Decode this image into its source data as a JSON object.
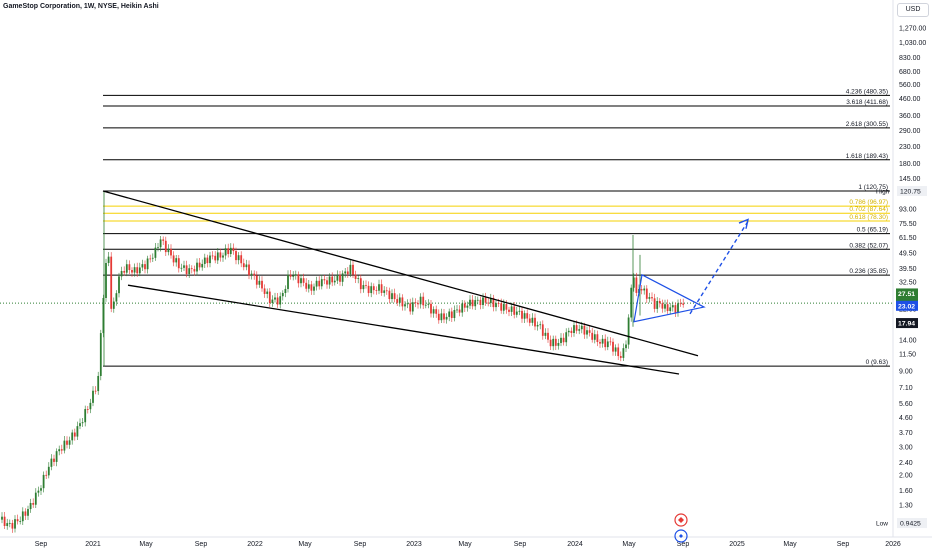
{
  "header": {
    "title": "GameStop Corporation, 1W, NYSE, Heikin Ashi",
    "currency": "USD"
  },
  "colors": {
    "up": "#26a69a",
    "up_candle": "#2e7d32",
    "down": "#e53935",
    "fib_line": "#000000",
    "fib_gold": "#f5d000",
    "triangle": "#1e50e6",
    "projection": "#1e50e6",
    "current_price_line": "#2e7d32",
    "bg": "#ffffff",
    "axis_text": "#131722"
  },
  "chart_data": {
    "type": "candlestick",
    "scale": "log",
    "x_ticks": [
      "Sep",
      "2021",
      "May",
      "Sep",
      "2022",
      "May",
      "Sep",
      "2023",
      "May",
      "Sep",
      "2024",
      "May",
      "Sep",
      "2025",
      "May",
      "Sep",
      "2026"
    ],
    "y_ticks": [
      1,
      1.3,
      1.6,
      2.0,
      2.4,
      3.0,
      3.7,
      4.6,
      5.6,
      7.1,
      9.0,
      11.5,
      14.0,
      17.5,
      22.0,
      27.0,
      32.5,
      39.5,
      49.5,
      61.5,
      75.5,
      93.0,
      145.0,
      180.0,
      230.0,
      290.0,
      360.0,
      460.0,
      560.0,
      680.0,
      830.0,
      1030.0,
      1270.0
    ],
    "y_tick_labels": [
      "1.06",
      "1.30",
      "1.60",
      "2.00",
      "2.40",
      "3.00",
      "3.70",
      "4.60",
      "5.60",
      "7.10",
      "9.00",
      "11.50",
      "14.00",
      "17.50",
      "22.00",
      "27.00",
      "32.50",
      "39.50",
      "49.50",
      "61.50",
      "75.50",
      "93.00",
      "145.00",
      "180.00",
      "230.00",
      "290.00",
      "360.00",
      "460.00",
      "560.00",
      "680.00",
      "830.00",
      "1,030.00",
      "1,270.00"
    ],
    "ylim": [
      0.87,
      1560
    ],
    "fib_levels": [
      {
        "ratio": "4.236",
        "price": 480.35,
        "label": "4.236 (480.35)",
        "style": "black"
      },
      {
        "ratio": "3.618",
        "price": 411.68,
        "label": "3.618 (411.68)",
        "style": "black"
      },
      {
        "ratio": "2.618",
        "price": 300.55,
        "label": "2.618 (300.55)",
        "style": "black"
      },
      {
        "ratio": "1.618",
        "price": 189.43,
        "label": "1.618 (189.43)",
        "style": "black"
      },
      {
        "ratio": "1",
        "price": 120.75,
        "label": "1 (120.75)",
        "style": "black"
      },
      {
        "ratio": "0.786",
        "price": 96.97,
        "label": "0.786 (96.97)",
        "style": "gold"
      },
      {
        "ratio": "0.702",
        "price": 87.64,
        "label": "0.702 (87.64)",
        "style": "gold"
      },
      {
        "ratio": "0.618",
        "price": 78.3,
        "label": "0.618 (78.30)",
        "style": "gold"
      },
      {
        "ratio": "0.5",
        "price": 65.19,
        "label": "0.5 (65.19)",
        "style": "black"
      },
      {
        "ratio": "0.382",
        "price": 52.07,
        "label": "0.382 (52.07)",
        "style": "black"
      },
      {
        "ratio": "0.236",
        "price": 35.85,
        "label": "0.236 (35.85)",
        "style": "black"
      },
      {
        "ratio": "0",
        "price": 9.63,
        "label": "0 (9.63)",
        "style": "black"
      }
    ],
    "price_badges": [
      {
        "text": "High",
        "value": "120.75",
        "kind": "plain"
      },
      {
        "text": "",
        "value": "27.51",
        "kind": "green"
      },
      {
        "text": "",
        "value": "23.92",
        "kind": "green"
      },
      {
        "text": "",
        "value": "23.02",
        "kind": "blue"
      },
      {
        "text": "",
        "value": "17.94",
        "kind": "dark"
      },
      {
        "text": "Low",
        "value": "0.9425",
        "kind": "plain"
      }
    ],
    "current_price": 23.92,
    "high": 120.75,
    "low": 0.9425,
    "annotations": {
      "upper_trendline": "descending resistance from 2021 high to 2024",
      "lower_trendline": "descending support 2021-2024",
      "symmetrical_triangle": "2024 consolidation",
      "projection_arrow": "breakout target toward ~78"
    },
    "candles_weekly_close": [
      [
        0,
        1.05
      ],
      [
        1,
        1.1
      ],
      [
        2,
        1.2
      ],
      [
        3,
        1.3
      ],
      [
        4,
        1.5
      ],
      [
        5,
        1.7
      ],
      [
        6,
        2.0
      ],
      [
        7,
        2.4
      ],
      [
        8,
        2.9
      ],
      [
        9,
        3.5
      ],
      [
        10,
        4.1
      ],
      [
        11,
        5.0
      ],
      [
        12,
        6.2
      ],
      [
        13,
        8.0
      ],
      [
        14,
        25
      ],
      [
        15,
        60
      ],
      [
        16,
        40
      ],
      [
        17,
        30
      ],
      [
        18,
        30
      ],
      [
        19,
        28
      ],
      [
        20,
        32
      ],
      [
        21,
        40
      ],
      [
        22,
        45
      ],
      [
        23,
        35
      ],
      [
        24,
        38
      ],
      [
        25,
        50
      ],
      [
        26,
        60
      ],
      [
        27,
        55
      ],
      [
        28,
        45
      ],
      [
        29,
        44
      ],
      [
        30,
        46
      ],
      [
        31,
        40
      ],
      [
        32,
        38
      ]
    ]
  },
  "footer_icons": [
    "logo-icon",
    "gear-icon"
  ]
}
